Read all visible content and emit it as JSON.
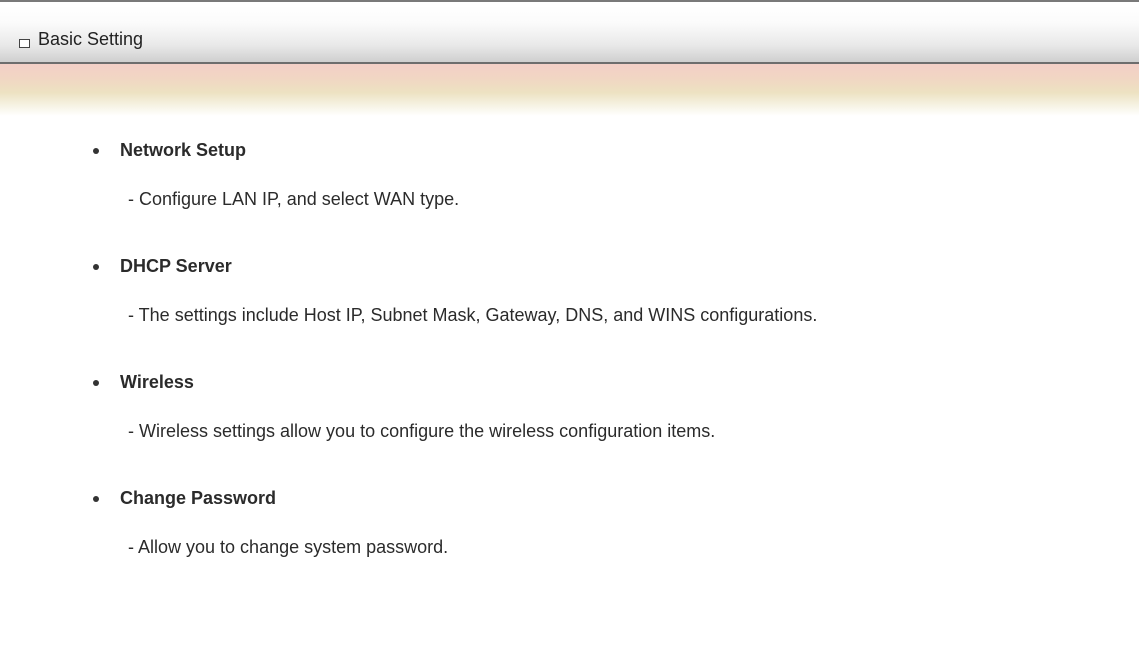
{
  "header": {
    "icon": "checkbox-square-icon",
    "title": "Basic Setting"
  },
  "items": [
    {
      "title": "Network Setup",
      "description": "- Configure LAN IP, and select WAN type."
    },
    {
      "title": "DHCP Server",
      "description": "- The settings include Host IP, Subnet Mask, Gateway, DNS, and WINS configurations."
    },
    {
      "title": "Wireless",
      "description": "- Wireless settings allow you to configure the wireless configuration items."
    },
    {
      "title": "Change Password",
      "description": "- Allow you to change system password."
    }
  ],
  "colors": {
    "accent_band": "#f1d6c3",
    "header_border": "#6d6d6d",
    "text": "#2b2b2b"
  }
}
